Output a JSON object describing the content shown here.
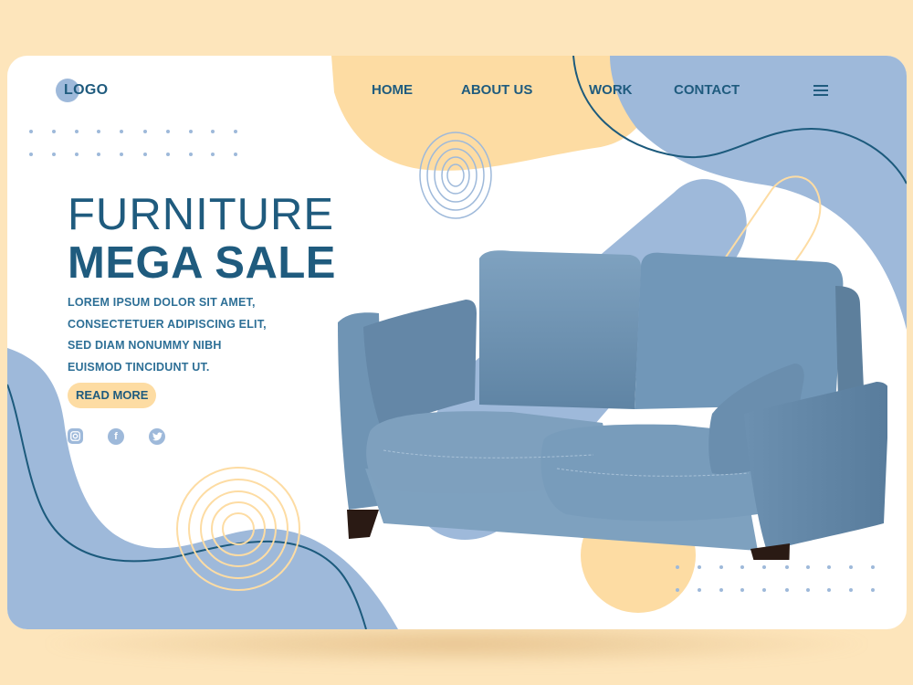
{
  "brand": {
    "logo_text": "LOGO"
  },
  "nav": {
    "items": [
      {
        "label": "HOME"
      },
      {
        "label": "ABOUT US"
      },
      {
        "label": "WORK"
      },
      {
        "label": "CONTACT"
      }
    ],
    "menu_icon": "hamburger-menu-icon"
  },
  "hero": {
    "title_line1": "FURNITURE",
    "title_line2": "MEGA SALE",
    "description": [
      "LOREM IPSUM DOLOR SIT AMET,",
      "CONSECTETUER ADIPISCING ELIT,",
      "SED DIAM NONUMMY NIBH",
      "EUISMOD TINCIDUNT UT."
    ],
    "cta_label": "READ MORE",
    "product_image": "blue-velvet-sofa"
  },
  "social": [
    {
      "icon": "instagram-icon",
      "glyph": "◎"
    },
    {
      "icon": "facebook-icon",
      "glyph": "f"
    },
    {
      "icon": "twitter-icon",
      "glyph": "✦"
    }
  ],
  "colors": {
    "page_bg": "#fde5bb",
    "card_bg": "#ffffff",
    "primary_text": "#1f5b7e",
    "accent_blue": "#9eb9da",
    "accent_peach": "#fddca3",
    "line_dark": "#1c5a7c"
  }
}
